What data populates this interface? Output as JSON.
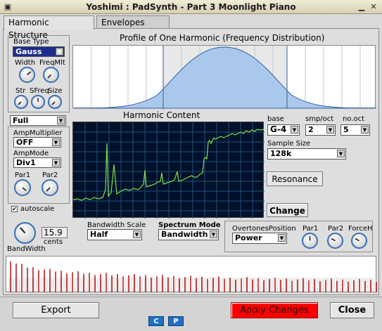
{
  "window": {
    "title": "Yoshimi : PadSynth - Part 3 Moonlight Piano"
  },
  "tabs": [
    {
      "label": "Harmonic Structure"
    },
    {
      "label": "Envelopes LFOs"
    }
  ],
  "left": {
    "base_type_label": "Base Type",
    "base_type_value": "Gauss",
    "width_label": "Width",
    "freqmlt_label": "FreqMlt",
    "str_label": "Str",
    "sfreq_label": "SFreq",
    "size_label": "Size",
    "full_value": "Full",
    "amp_multiplier_label": "AmpMultiplier",
    "amp_multiplier_value": "OFF",
    "amp_mode_label": "AmpMode",
    "amp_mode_value": "Div1",
    "par1_label": "Par1",
    "par2_label": "Par2",
    "autoscale_label": "autoscale",
    "autoscale_checked": true
  },
  "profile": {
    "title": "Profile of One Harmonic (Frequency Distribution)"
  },
  "harmonic_content": {
    "title": "Harmonic Content"
  },
  "right": {
    "base_label": "base",
    "base_value": "G-4",
    "smp_oct_label": "smp/oct",
    "smp_oct_value": "2",
    "no_oct_label": "no.oct",
    "no_oct_value": "5",
    "sample_size_label": "Sample Size",
    "sample_size_value": "128k",
    "resonance_label": "Resonance",
    "change_label": "Change"
  },
  "bandwidth": {
    "label": "BandWidth",
    "value": "15.9",
    "unit": "cents",
    "scale_label": "Bandwidth Scale",
    "scale_value": "Half",
    "spectrum_mode_label": "Spectrum Mode",
    "spectrum_mode_value": "Bandwidth"
  },
  "overtones": {
    "position_label": "OvertonesPosition",
    "position_value": "Power",
    "par1_label": "Par1",
    "par2_label": "Par2",
    "forceh_label": "ForceH"
  },
  "footer": {
    "export_label": "Export",
    "apply_label": "Apply Changes",
    "close_label": "Close",
    "c_label": "C",
    "p_label": "P"
  },
  "colors": {
    "accent": "#3b6fb6",
    "apply_bg": "#ff0000",
    "scope_bg": "#00102a",
    "scope_trace": "#7fe04a",
    "profile_fill": "#a9c8ec",
    "harmonic_bar": "#b00000"
  }
}
